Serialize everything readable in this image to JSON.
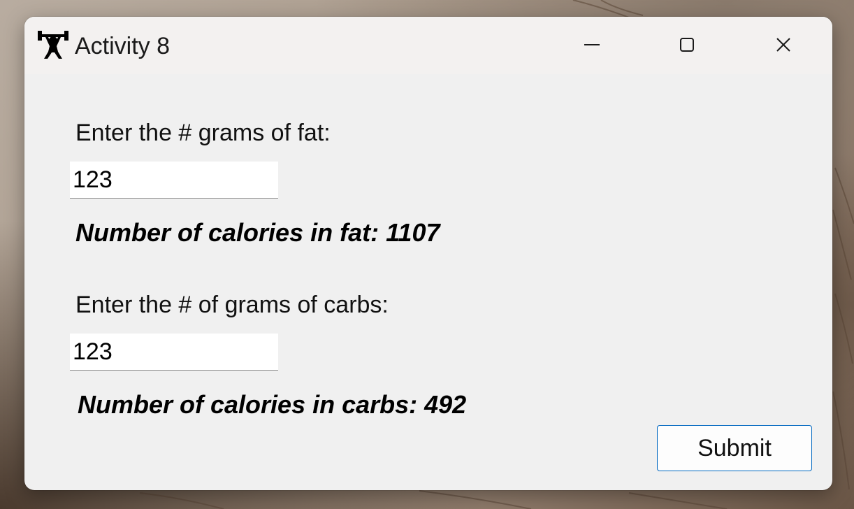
{
  "window": {
    "title": "Activity 8",
    "icon": "weightlifter-icon",
    "controls": {
      "minimize": "minimize-icon",
      "maximize": "maximize-icon",
      "close": "close-icon"
    }
  },
  "form": {
    "fat_label": "Enter the # grams of fat:",
    "fat_value": "123",
    "fat_result": "Number of calories in fat: 1107",
    "carbs_label": "Enter the # of grams of carbs:",
    "carbs_value": "123",
    "carbs_result": "Number of calories in carbs: 492",
    "submit_label": "Submit"
  },
  "colors": {
    "window_bg": "#f0f0f0",
    "titlebar_bg": "#f3f1f0",
    "accent_border": "#0067c0"
  }
}
